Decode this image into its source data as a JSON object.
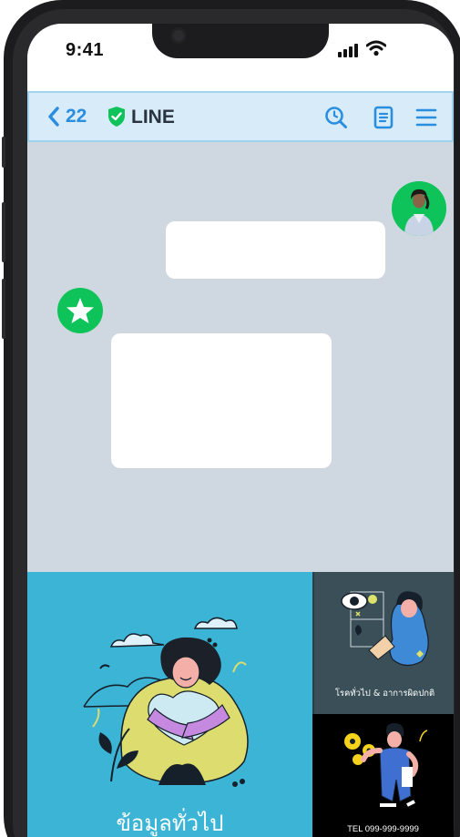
{
  "status_bar": {
    "time": "9:41"
  },
  "navbar": {
    "back_count": "22",
    "title": "LINE",
    "icons": [
      "chevron-left-icon",
      "shield-check-icon",
      "search-icon",
      "notes-icon",
      "menu-icon"
    ]
  },
  "chat": {
    "user_avatar": "user-avatar",
    "official_account_avatar": "star-icon"
  },
  "rich_menu": {
    "main_label": "ข้อมูลทั่วไป",
    "top_right_label": "โรคทั่วไป & อาการผิดปกติ",
    "bottom_right_label": "TEL 099-999-9999"
  },
  "colors": {
    "line_green": "#0ec45a",
    "nav_blue": "#2a8ee0",
    "rich_menu_main": "#3bb4d6",
    "rich_menu_top": "#3a4f57",
    "rich_menu_bottom": "#000000"
  }
}
